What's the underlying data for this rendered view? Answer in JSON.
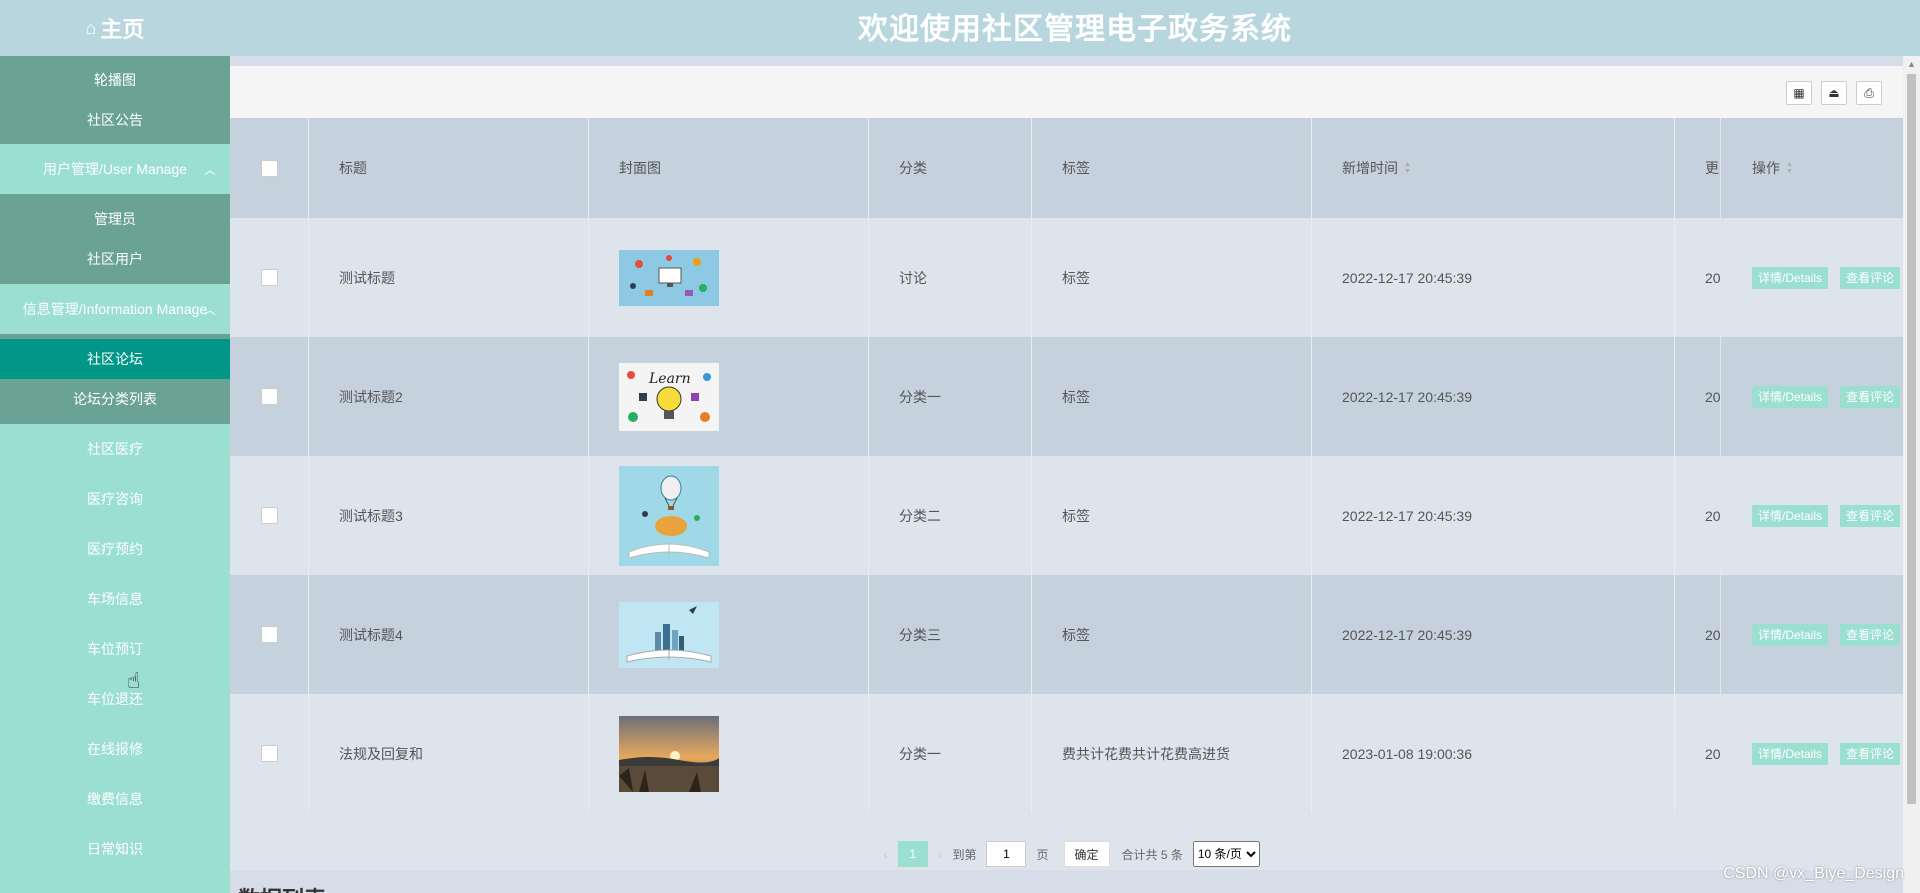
{
  "header": {
    "home_icon": "home-icon",
    "home_label": "主页",
    "title": "欢迎使用社区管理电子政务系统"
  },
  "sidebar": {
    "top_items": [
      "轮播图",
      "社区公告"
    ],
    "user_group": {
      "label": "用户管理/User Manage",
      "items": [
        "管理员",
        "社区用户"
      ]
    },
    "info_group": {
      "label": "信息管理/Information Manage",
      "items": [
        "社区论坛",
        "论坛分类列表"
      ],
      "active": "社区论坛"
    },
    "menu_items": [
      "社区医疗",
      "医疗咨询",
      "医疗预约",
      "车场信息",
      "车位预订",
      "车位退还",
      "在线报修",
      "缴费信息",
      "日常知识"
    ]
  },
  "toolbar": {
    "icons": [
      "qrcode-icon",
      "export-icon",
      "print-icon"
    ],
    "glyphs": [
      "▦",
      "⏏",
      "⎙"
    ]
  },
  "table": {
    "headers": [
      "标题",
      "封面图",
      "分类",
      "标签",
      "新增时间",
      "更",
      "操作"
    ],
    "rows": [
      {
        "title": "测试标题",
        "category": "讨论",
        "tag": "标签",
        "time": "2022-12-17 20:45:39",
        "more": "20"
      },
      {
        "title": "测试标题2",
        "category": "分类一",
        "tag": "标签",
        "time": "2022-12-17 20:45:39",
        "more": "20"
      },
      {
        "title": "测试标题3",
        "category": "分类二",
        "tag": "标签",
        "time": "2022-12-17 20:45:39",
        "more": "20"
      },
      {
        "title": "测试标题4",
        "category": "分类三",
        "tag": "标签",
        "time": "2022-12-17 20:45:39",
        "more": "20"
      },
      {
        "title": "法规及回复和",
        "category": "分类一",
        "tag": "费共计花费共计花费高进货",
        "time": "2023-01-08 19:00:36",
        "more": "20"
      }
    ],
    "actions": {
      "details": "详情/Details",
      "comments": "查看评论"
    }
  },
  "pager": {
    "prev": "‹",
    "next": "›",
    "current": "1",
    "goto_label": "到第",
    "goto_value": "1",
    "page_unit": "页",
    "confirm": "确定",
    "total": "合计共 5 条",
    "page_size": "10 条/页"
  },
  "section_title": "数据列表",
  "watermark": "CSDN @vx_Biye_Design",
  "colors": {
    "header": "#b7d6dd",
    "sidebar": "#9adfcf",
    "sidebar_group": "#6aa394",
    "active": "#009688",
    "accent": "#9adfcf"
  }
}
